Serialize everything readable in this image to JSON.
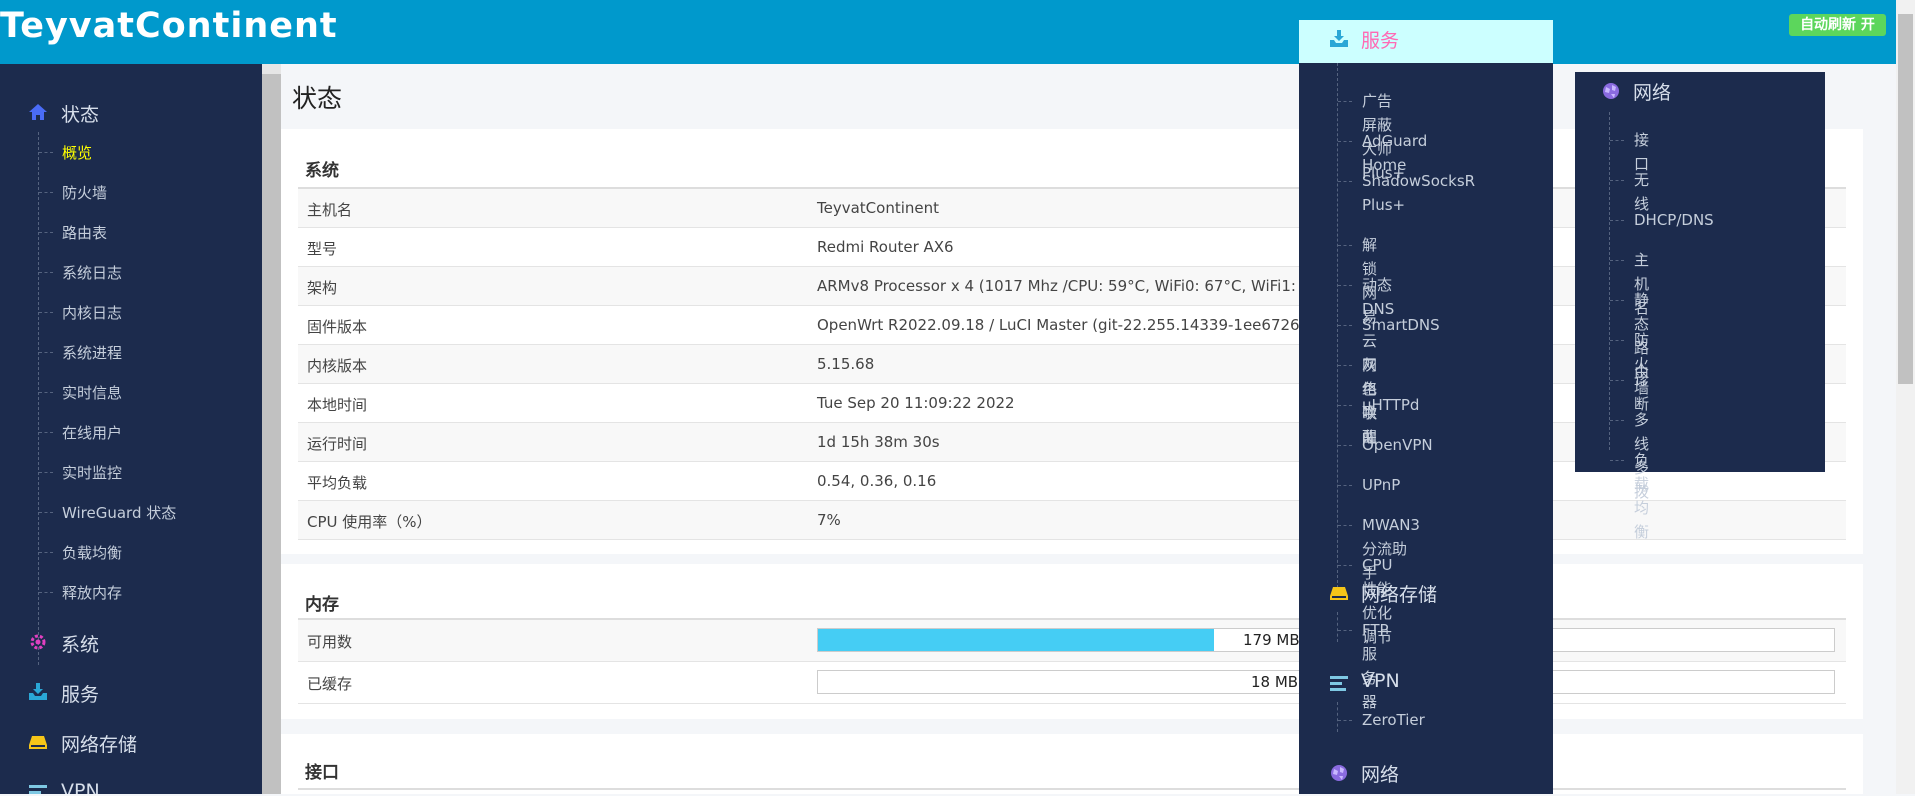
{
  "header": {
    "brand": "TeyvatContinent",
    "refresh_label": "自动刷新 开",
    "colors": {
      "bar": "#0099cc",
      "refresh": "#5cd65c"
    }
  },
  "sidebar": {
    "status": {
      "label": "状态",
      "icon": "home-icon",
      "items": [
        "概览",
        "防火墙",
        "路由表",
        "系统日志",
        "内核日志",
        "系统进程",
        "实时信息",
        "在线用户",
        "实时监控",
        "WireGuard 状态",
        "负载均衡",
        "释放内存"
      ]
    },
    "groups": [
      {
        "label": "系统",
        "icon": "gear-icon"
      },
      {
        "label": "服务",
        "icon": "download-tray-icon"
      },
      {
        "label": "网络存储",
        "icon": "drive-icon"
      },
      {
        "label": "VPN",
        "icon": "vpn-lines-icon"
      }
    ]
  },
  "main": {
    "page_title": "状态",
    "system": {
      "title": "系统",
      "rows": [
        {
          "k": "主机名",
          "v": "TeyvatContinent"
        },
        {
          "k": "型号",
          "v": "Redmi Router AX6"
        },
        {
          "k": "架构",
          "v": "ARMv8 Processor x 4  (1017 Mhz /CPU: 59°C, WiFi0: 67°C, WiFi1: 61°C)"
        },
        {
          "k": "固件版本",
          "v": "OpenWrt R2022.09.18 / LuCI Master (git-22.255.14339-1ee6726)"
        },
        {
          "k": "内核版本",
          "v": "5.15.68"
        },
        {
          "k": "本地时间",
          "v": "Tue Sep 20 11:09:22 2022"
        },
        {
          "k": "运行时间",
          "v": "1d 15h 38m 30s"
        },
        {
          "k": "平均负载",
          "v": "0.54, 0.36, 0.16"
        },
        {
          "k": "CPU 使用率（%）",
          "v": "7%"
        }
      ]
    },
    "memory": {
      "title": "内存",
      "rows": [
        {
          "k": "可用数",
          "text": "179 MB",
          "fill_fraction": 0.39
        },
        {
          "k": "已缓存",
          "text": "18 MB",
          "fill_fraction": 0.0
        }
      ],
      "bar_color": "#45cdf4"
    },
    "interfaces": {
      "title": "接口"
    }
  },
  "menu_services": {
    "header": "服务",
    "header_colors": {
      "bg": "#ccffff",
      "text": "#ff69b4"
    },
    "items": [
      "广告屏蔽大师 Plus+",
      "AdGuard Home",
      "ShadowSocksR",
      "Plus+",
      "解锁网易云灰色歌曲",
      "动态 DNS",
      "SmartDNS",
      "网络唤醒",
      "uHTTPd",
      "OpenVPN",
      "UPnP",
      "MWAN3 分流助手",
      "CPU 性能优化调节"
    ],
    "storage": {
      "label": "网络存储",
      "items": [
        "FTP 服务器"
      ]
    },
    "vpn": {
      "label": "VPN",
      "items": [
        "ZeroTier"
      ]
    },
    "network": {
      "label": "网络"
    }
  },
  "menu_network": {
    "label": "网络",
    "items": [
      "接口",
      "无线",
      "DHCP/DNS",
      "主机名",
      "静态路由",
      "防火墙",
      "诊断",
      "多线多拨",
      "负载均衡"
    ]
  }
}
